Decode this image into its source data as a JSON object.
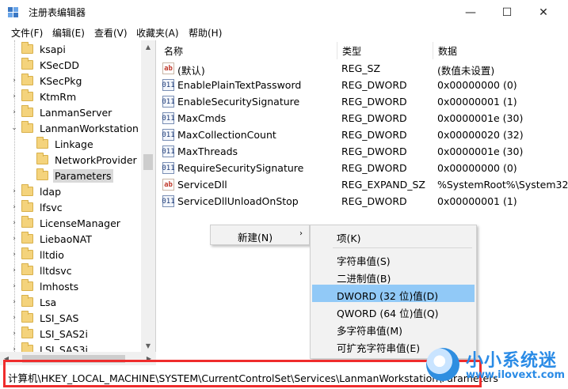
{
  "window": {
    "title": "注册表编辑器",
    "min": "—",
    "max": "☐",
    "close": "✕"
  },
  "menu": [
    "文件(F)",
    "编辑(E)",
    "查看(V)",
    "收藏夹(A)",
    "帮助(H)"
  ],
  "tree": [
    {
      "label": "ksapi",
      "expander": ""
    },
    {
      "label": "KSecDD",
      "expander": ""
    },
    {
      "label": "KSecPkg",
      "expander": "›"
    },
    {
      "label": "KtmRm",
      "expander": "›"
    },
    {
      "label": "LanmanServer",
      "expander": "›"
    },
    {
      "label": "LanmanWorkstation",
      "expander": "⌄"
    },
    {
      "label": "Linkage",
      "expander": ""
    },
    {
      "label": "NetworkProvider",
      "expander": ""
    },
    {
      "label": "Parameters",
      "expander": ""
    },
    {
      "label": "ldap",
      "expander": "›"
    },
    {
      "label": "lfsvc",
      "expander": "›"
    },
    {
      "label": "LicenseManager",
      "expander": "›"
    },
    {
      "label": "LiebaoNAT",
      "expander": "›"
    },
    {
      "label": "lltdio",
      "expander": "›"
    },
    {
      "label": "lltdsvc",
      "expander": "›"
    },
    {
      "label": "lmhosts",
      "expander": "›"
    },
    {
      "label": "Lsa",
      "expander": "›"
    },
    {
      "label": "LSI_SAS",
      "expander": "›"
    },
    {
      "label": "LSI_SAS2i",
      "expander": "›"
    },
    {
      "label": "LSI_SAS3i",
      "expander": "›"
    }
  ],
  "columns": {
    "name": "名称",
    "type": "类型",
    "data": "数据"
  },
  "values": [
    {
      "icon": "ab",
      "name": "(默认)",
      "type": "REG_SZ",
      "data": "(数值未设置)"
    },
    {
      "icon": "bin",
      "name": "EnablePlainTextPassword",
      "type": "REG_DWORD",
      "data": "0x00000000 (0)"
    },
    {
      "icon": "bin",
      "name": "EnableSecuritySignature",
      "type": "REG_DWORD",
      "data": "0x00000001 (1)"
    },
    {
      "icon": "bin",
      "name": "MaxCmds",
      "type": "REG_DWORD",
      "data": "0x0000001e (30)"
    },
    {
      "icon": "bin",
      "name": "MaxCollectionCount",
      "type": "REG_DWORD",
      "data": "0x00000020 (32)"
    },
    {
      "icon": "bin",
      "name": "MaxThreads",
      "type": "REG_DWORD",
      "data": "0x0000001e (30)"
    },
    {
      "icon": "bin",
      "name": "RequireSecuritySignature",
      "type": "REG_DWORD",
      "data": "0x00000000 (0)"
    },
    {
      "icon": "ab",
      "name": "ServiceDll",
      "type": "REG_EXPAND_SZ",
      "data": "%SystemRoot%\\System32\\"
    },
    {
      "icon": "bin",
      "name": "ServiceDllUnloadOnStop",
      "type": "REG_DWORD",
      "data": "0x00000001 (1)"
    }
  ],
  "context_menu": {
    "new_label": "新建(N)",
    "arrow": "›"
  },
  "submenu": {
    "key": "项(K)",
    "string": "字符串值(S)",
    "binary": "二进制值(B)",
    "dword": "DWORD (32 位)值(D)",
    "qword": "QWORD (64 位)值(Q)",
    "multi_string": "多字符串值(M)",
    "expand_string": "可扩充字符串值(E)"
  },
  "status": {
    "path": "计算机\\HKEY_LOCAL_MACHINE\\SYSTEM\\CurrentControlSet\\Services\\LanmanWorkstation\\Parameters"
  },
  "watermark": {
    "brand": "小小系统迷",
    "url": "www.ilovext.com"
  },
  "colors": {
    "highlight": "#91c9f7",
    "status_box": "#ef2c2c",
    "watermark": "#2a8be6"
  }
}
